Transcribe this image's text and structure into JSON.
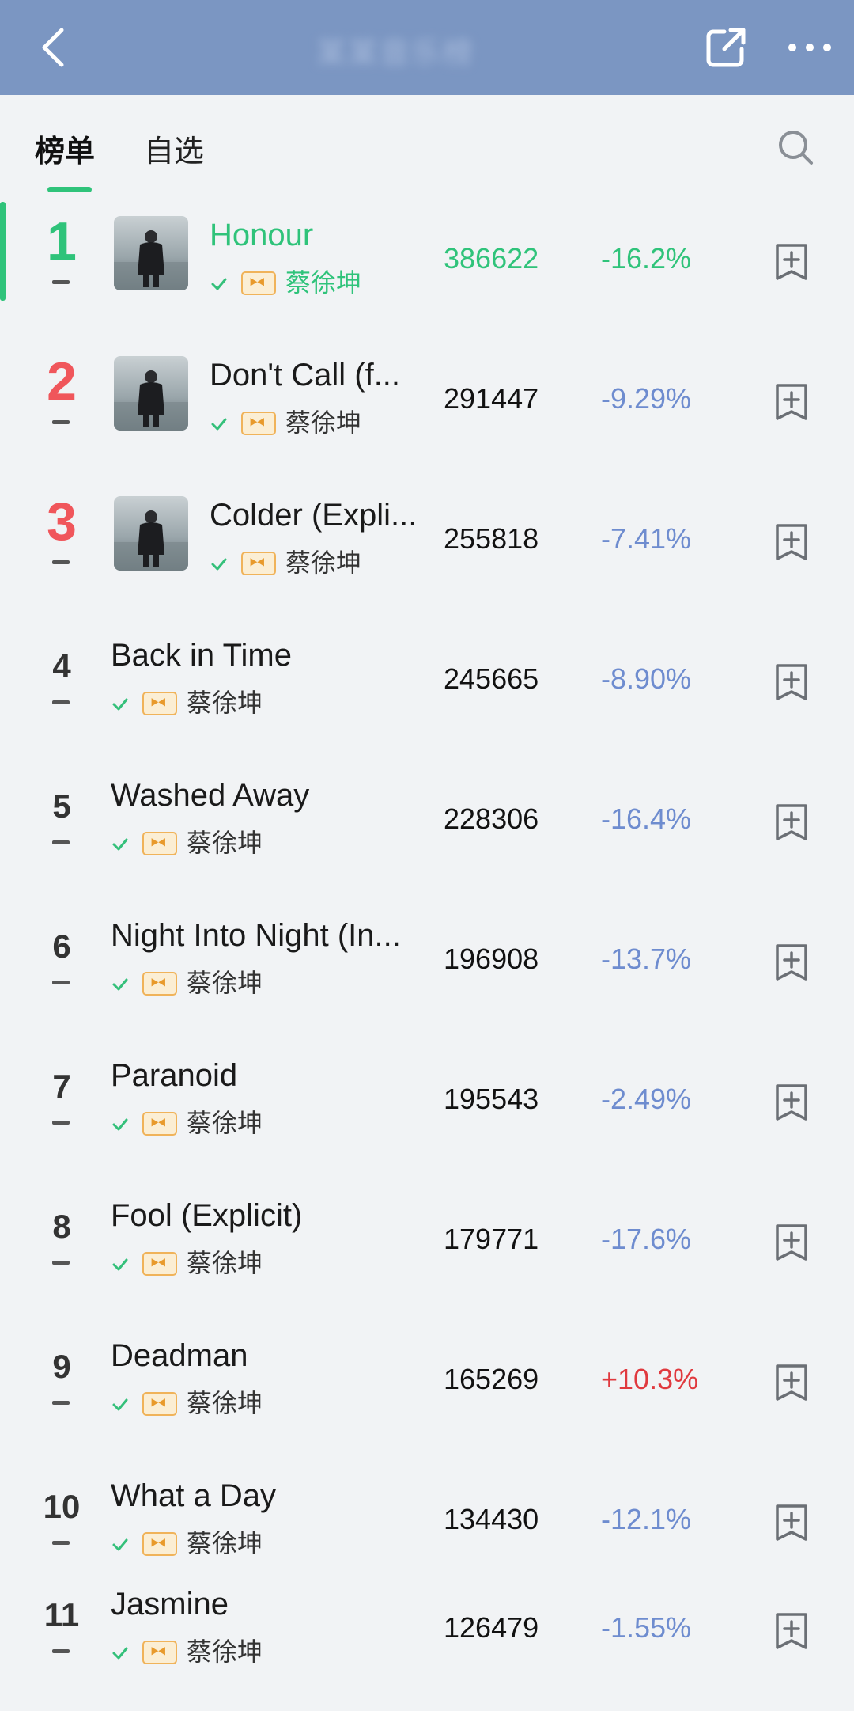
{
  "header": {
    "title": "某某音乐榜",
    "back_icon": "chevron-left-icon",
    "share_icon": "share-icon",
    "more_icon": "more-icon"
  },
  "tabs": [
    {
      "label": "榜单",
      "active": true
    },
    {
      "label": "自选",
      "active": false
    }
  ],
  "colors": {
    "accent": "#2fc37a",
    "decline": "#6e8ccf",
    "rise": "#e0393e",
    "top_rank": "#f0565b"
  },
  "rows": [
    {
      "rank": "1",
      "title": "Honour",
      "artist": "蔡徐坤",
      "plays": "386622",
      "change": "-16.2%",
      "highlighted": true,
      "cover": true
    },
    {
      "rank": "2",
      "title": "Don't Call (f...",
      "artist": "蔡徐坤",
      "plays": "291447",
      "change": "-9.29%",
      "cover": true
    },
    {
      "rank": "3",
      "title": "Colder (Expli...",
      "artist": "蔡徐坤",
      "plays": "255818",
      "change": "-7.41%",
      "cover": true
    },
    {
      "rank": "4",
      "title": "Back in Time",
      "artist": "蔡徐坤",
      "plays": "245665",
      "change": "-8.90%"
    },
    {
      "rank": "5",
      "title": "Washed Away",
      "artist": "蔡徐坤",
      "plays": "228306",
      "change": "-16.4%"
    },
    {
      "rank": "6",
      "title": "Night Into Night (In...",
      "artist": "蔡徐坤",
      "plays": "196908",
      "change": "-13.7%"
    },
    {
      "rank": "7",
      "title": "Paranoid",
      "artist": "蔡徐坤",
      "plays": "195543",
      "change": "-2.49%"
    },
    {
      "rank": "8",
      "title": "Fool (Explicit)",
      "artist": "蔡徐坤",
      "plays": "179771",
      "change": "-17.6%"
    },
    {
      "rank": "9",
      "title": "Deadman",
      "artist": "蔡徐坤",
      "plays": "165269",
      "change": "+10.3%"
    },
    {
      "rank": "10",
      "title": "What a Day",
      "artist": "蔡徐坤",
      "plays": "134430",
      "change": "-12.1%"
    },
    {
      "rank": "11",
      "title": "Jasmine",
      "artist": "蔡徐坤",
      "plays": "126479",
      "change": "-1.55%"
    }
  ]
}
